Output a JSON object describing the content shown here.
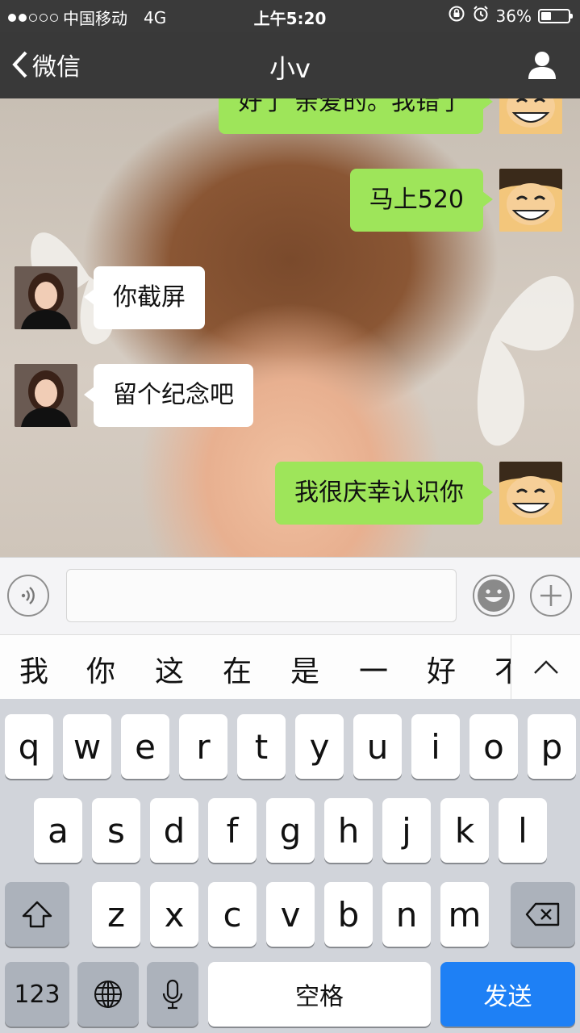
{
  "status_bar": {
    "carrier": "中国移动",
    "network": "4G",
    "time": "上午5:20",
    "battery": "36%",
    "battery_level": 0.36
  },
  "nav": {
    "back_label": "微信",
    "title": "小v"
  },
  "messages": [
    {
      "side": "right",
      "text": "好了 亲爱的。我错了"
    },
    {
      "side": "right",
      "text": "马上520"
    },
    {
      "side": "left",
      "text": "你截屏"
    },
    {
      "side": "left",
      "text": "留个纪念吧"
    },
    {
      "side": "right",
      "text": "我很庆幸认识你"
    }
  ],
  "input": {
    "placeholder": ""
  },
  "candidates": [
    "我",
    "你",
    "这",
    "在",
    "是",
    "一",
    "好",
    "不"
  ],
  "keyboard": {
    "row1": [
      "q",
      "w",
      "e",
      "r",
      "t",
      "y",
      "u",
      "i",
      "o",
      "p"
    ],
    "row2": [
      "a",
      "s",
      "d",
      "f",
      "g",
      "h",
      "j",
      "k",
      "l"
    ],
    "row3": [
      "z",
      "x",
      "c",
      "v",
      "b",
      "n",
      "m"
    ],
    "numbers_label": "123",
    "space_label": "空格",
    "send_label": "发送"
  },
  "icons": {
    "back": "chevron-left-icon",
    "user": "person-icon",
    "voice": "voice-icon",
    "emoji": "emoji-icon",
    "add": "plus-icon",
    "shift": "shift-icon",
    "delete": "backspace-icon",
    "globe": "globe-icon",
    "mic": "microphone-icon",
    "collapse": "chevron-up-icon"
  },
  "colors": {
    "nav_bg": "#393939",
    "sent_bubble": "#9ee55a",
    "received_bubble": "#ffffff",
    "send_key": "#1e80f5"
  }
}
